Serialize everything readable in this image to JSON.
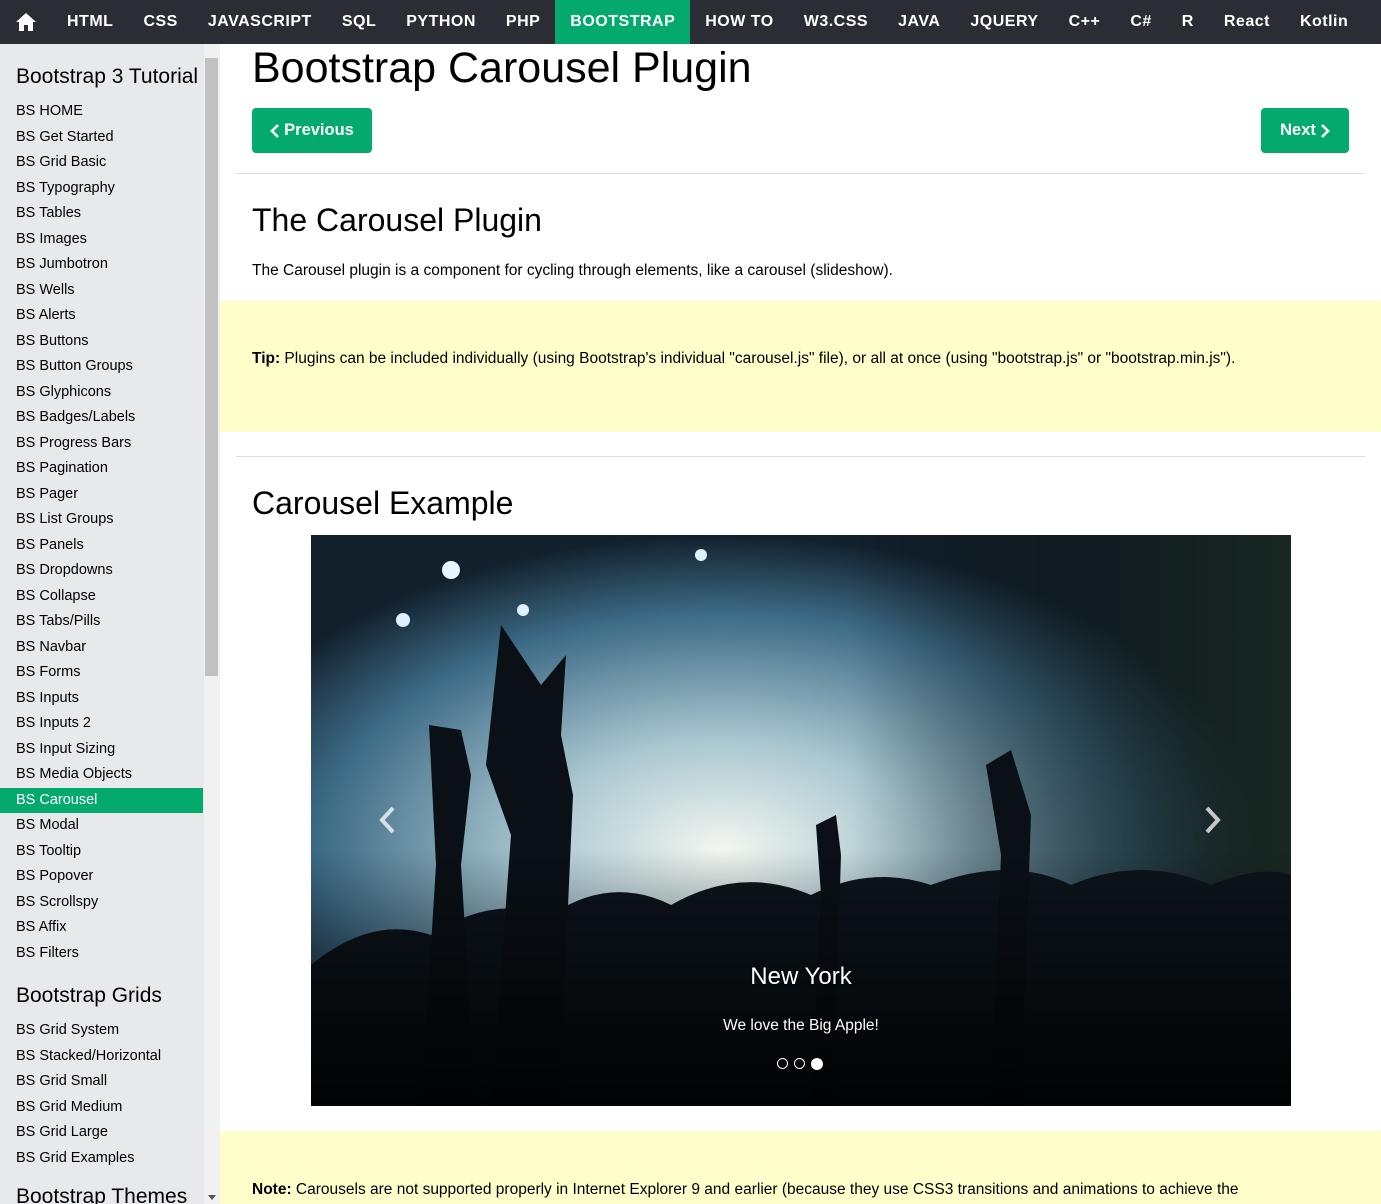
{
  "topnav": {
    "home_icon": "home-icon",
    "items": [
      "HTML",
      "CSS",
      "JAVASCRIPT",
      "SQL",
      "PYTHON",
      "PHP",
      "BOOTSTRAP",
      "HOW TO",
      "W3.CSS",
      "JAVA",
      "JQUERY",
      "C++",
      "C#",
      "R",
      "React",
      "Kotlin"
    ],
    "active": "BOOTSTRAP"
  },
  "sidebar": {
    "heading_tutorial": "Bootstrap 3 Tutorial",
    "tutorial_links": [
      "BS HOME",
      "BS Get Started",
      "BS Grid Basic",
      "BS Typography",
      "BS Tables",
      "BS Images",
      "BS Jumbotron",
      "BS Wells",
      "BS Alerts",
      "BS Buttons",
      "BS Button Groups",
      "BS Glyphicons",
      "BS Badges/Labels",
      "BS Progress Bars",
      "BS Pagination",
      "BS Pager",
      "BS List Groups",
      "BS Panels",
      "BS Dropdowns",
      "BS Collapse",
      "BS Tabs/Pills",
      "BS Navbar",
      "BS Forms",
      "BS Inputs",
      "BS Inputs 2",
      "BS Input Sizing",
      "BS Media Objects",
      "BS Carousel",
      "BS Modal",
      "BS Tooltip",
      "BS Popover",
      "BS Scrollspy",
      "BS Affix",
      "BS Filters"
    ],
    "active_link": "BS Carousel",
    "heading_grids": "Bootstrap Grids",
    "grid_links": [
      "BS Grid System",
      "BS Stacked/Horizontal",
      "BS Grid Small",
      "BS Grid Medium",
      "BS Grid Large",
      "BS Grid Examples"
    ],
    "heading_themes": "Bootstrap Themes"
  },
  "main": {
    "page_title": "Bootstrap Carousel Plugin",
    "prev_label": "Previous",
    "next_label": "Next",
    "section_title": "The Carousel Plugin",
    "intro": "The Carousel plugin is a component for cycling through elements, like a carousel (slideshow).",
    "tip_label": "Tip:",
    "tip_text": " Plugins can be included individually (using Bootstrap's individual \"carousel.js\" file), or all at once (using \"bootstrap.js\" or \"bootstrap.min.js\").",
    "example_title": "Carousel Example",
    "note_label": "Note:",
    "note_text": " Carousels are not supported properly in Internet Explorer 9 and earlier (because they use CSS3 transitions and animations to achieve the"
  },
  "carousel": {
    "caption_title": "New York",
    "caption_text": "We love the Big Apple!",
    "slide_count": 3,
    "active_slide": 3,
    "prev_icon": "chevron-left-icon",
    "next_icon": "chevron-right-icon"
  },
  "colors": {
    "accent": "#04aa6d",
    "nav_bg": "#2c2c34",
    "sidebar_bg": "#e7e9eb",
    "tip_bg": "#ffffcc"
  }
}
